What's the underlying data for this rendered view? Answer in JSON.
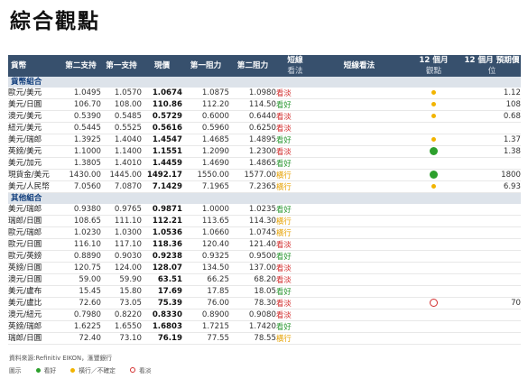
{
  "title": "綜合觀點",
  "headers": {
    "pair": "貨幣",
    "s2": "第二支持",
    "s1": "第一支持",
    "spot": "現價",
    "r1": "第一阻力",
    "r2": "第二阻力",
    "short_view_line1": "短線",
    "short_view_line2": "看法",
    "short_comment": "短線看法",
    "m12_line1": "12 個月",
    "m12_line2": "觀點",
    "target_line1": "12 個月 預期價",
    "target_line2": "位"
  },
  "sections": [
    {
      "name": "貨幣組合",
      "rows": [
        {
          "pair": "歐元/美元",
          "s2": "1.0495",
          "s1": "1.0570",
          "spot": "1.0674",
          "r1": "1.0875",
          "r2": "1.0980",
          "view": "看淡",
          "view_type": "bear",
          "indicator": "yellow",
          "target": "1.12"
        },
        {
          "pair": "美元/日圓",
          "s2": "106.70",
          "s1": "108.00",
          "spot": "110.86",
          "r1": "112.20",
          "r2": "114.50",
          "view": "看好",
          "view_type": "bull",
          "indicator": "yellow",
          "target": "108"
        },
        {
          "pair": "澳元/美元",
          "s2": "0.5390",
          "s1": "0.5485",
          "spot": "0.5729",
          "r1": "0.6000",
          "r2": "0.6440",
          "view": "看淡",
          "view_type": "bear",
          "indicator": "yellow",
          "target": "0.68"
        },
        {
          "pair": "紐元/美元",
          "s2": "0.5445",
          "s1": "0.5525",
          "spot": "0.5616",
          "r1": "0.5960",
          "r2": "0.6250",
          "view": "看淡",
          "view_type": "bear",
          "indicator": "",
          "target": ""
        },
        {
          "pair": "美元/瑞郎",
          "s2": "1.3925",
          "s1": "1.4040",
          "spot": "1.4547",
          "r1": "1.4685",
          "r2": "1.4895",
          "view": "看好",
          "view_type": "bull",
          "indicator": "yellow",
          "target": "1.37"
        },
        {
          "pair": "英鎊/美元",
          "s2": "1.1000",
          "s1": "1.1400",
          "spot": "1.1551",
          "r1": "1.2090",
          "r2": "1.2300",
          "view": "看淡",
          "view_type": "bear",
          "indicator": "green",
          "target": "1.38"
        },
        {
          "pair": "美元/加元",
          "s2": "1.3805",
          "s1": "1.4010",
          "spot": "1.4459",
          "r1": "1.4690",
          "r2": "1.4865",
          "view": "看好",
          "view_type": "bull",
          "indicator": "",
          "target": ""
        },
        {
          "pair": "現貨金/美元",
          "s2": "1430.00",
          "s1": "1445.00",
          "spot": "1492.17",
          "r1": "1550.00",
          "r2": "1577.00",
          "view": "橫行",
          "view_type": "neutral",
          "indicator": "green",
          "target": "1800"
        },
        {
          "pair": "美元/人民幣",
          "s2": "7.0560",
          "s1": "7.0870",
          "spot": "7.1429",
          "r1": "7.1965",
          "r2": "7.2365",
          "view": "橫行",
          "view_type": "neutral",
          "indicator": "yellow",
          "target": "6.93"
        }
      ]
    },
    {
      "name": "其他組合",
      "rows": [
        {
          "pair": "美元/瑞郎",
          "s2": "0.9380",
          "s1": "0.9765",
          "spot": "0.9871",
          "r1": "1.0000",
          "r2": "1.0235",
          "view": "看好",
          "view_type": "bull",
          "indicator": "",
          "target": ""
        },
        {
          "pair": "瑞郎/日圓",
          "s2": "108.65",
          "s1": "111.10",
          "spot": "112.21",
          "r1": "113.65",
          "r2": "114.30",
          "view": "橫行",
          "view_type": "neutral",
          "indicator": "",
          "target": ""
        },
        {
          "pair": "歐元/瑞郎",
          "s2": "1.0230",
          "s1": "1.0300",
          "spot": "1.0536",
          "r1": "1.0660",
          "r2": "1.0745",
          "view": "橫行",
          "view_type": "neutral",
          "indicator": "",
          "target": ""
        },
        {
          "pair": "歐元/日圓",
          "s2": "116.10",
          "s1": "117.10",
          "spot": "118.36",
          "r1": "120.40",
          "r2": "121.40",
          "view": "看淡",
          "view_type": "bear",
          "indicator": "",
          "target": ""
        },
        {
          "pair": "歐元/英鎊",
          "s2": "0.8890",
          "s1": "0.9030",
          "spot": "0.9238",
          "r1": "0.9325",
          "r2": "0.9500",
          "view": "看好",
          "view_type": "bull",
          "indicator": "",
          "target": ""
        },
        {
          "pair": "英鎊/日圓",
          "s2": "120.75",
          "s1": "124.00",
          "spot": "128.07",
          "r1": "134.50",
          "r2": "137.00",
          "view": "看淡",
          "view_type": "bear",
          "indicator": "",
          "target": ""
        },
        {
          "pair": "澳元/日圓",
          "s2": "59.00",
          "s1": "59.90",
          "spot": "63.51",
          "r1": "66.25",
          "r2": "68.20",
          "view": "看淡",
          "view_type": "bear",
          "indicator": "",
          "target": ""
        },
        {
          "pair": "美元/盧布",
          "s2": "15.45",
          "s1": "15.80",
          "spot": "17.69",
          "r1": "17.85",
          "r2": "18.05",
          "view": "看好",
          "view_type": "bull",
          "indicator": "",
          "target": ""
        },
        {
          "pair": "美元/盧比",
          "s2": "72.60",
          "s1": "73.05",
          "spot": "75.39",
          "r1": "76.00",
          "r2": "78.30",
          "view": "看淡",
          "view_type": "bear",
          "indicator": "red",
          "target": "70"
        },
        {
          "pair": "澳元/紐元",
          "s2": "0.7980",
          "s1": "0.8220",
          "spot": "0.8330",
          "r1": "0.8900",
          "r2": "0.9080",
          "view": "看淡",
          "view_type": "bear",
          "indicator": "",
          "target": ""
        },
        {
          "pair": "英鎊/瑞郎",
          "s2": "1.6225",
          "s1": "1.6550",
          "spot": "1.6803",
          "r1": "1.7215",
          "r2": "1.7420",
          "view": "看好",
          "view_type": "bull",
          "indicator": "",
          "target": ""
        },
        {
          "pair": "瑞郎/日圓",
          "s2": "72.40",
          "s1": "73.10",
          "spot": "76.19",
          "r1": "77.55",
          "r2": "78.55",
          "view": "橫行",
          "view_type": "neutral",
          "indicator": "",
          "target": ""
        }
      ]
    }
  ],
  "source": "資料來源:Refinitiv EIKON，滙豐銀行",
  "legend": {
    "label": "圖示",
    "items": [
      {
        "type": "green",
        "text": "看好"
      },
      {
        "type": "yellow",
        "text": "橫行／不確定"
      },
      {
        "type": "red",
        "text": "看淡"
      }
    ]
  },
  "colors": {
    "header_bg": "#37506d",
    "section_bg": "#dde3ea",
    "bearish": "#d32f2f",
    "bullish": "#2e9a35",
    "neutral": "#e6a100"
  }
}
